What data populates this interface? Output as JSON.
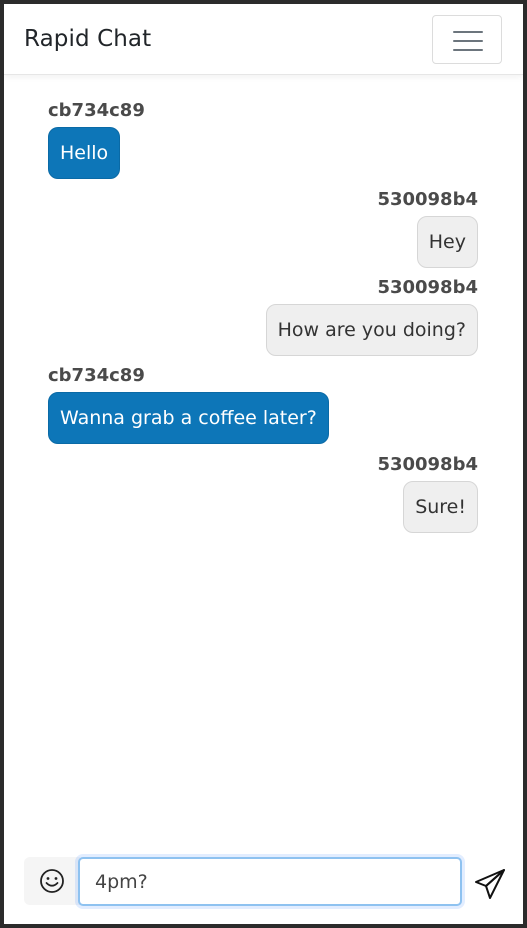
{
  "app": {
    "title": "Rapid Chat"
  },
  "navbar": {
    "menu_icon": "hamburger-menu-icon"
  },
  "messages": [
    {
      "sender": "cb734c89",
      "text": "Hello",
      "side": "left"
    },
    {
      "sender": "530098b4",
      "text": "Hey",
      "side": "right"
    },
    {
      "sender": "530098b4",
      "text": "How are you doing?",
      "side": "right"
    },
    {
      "sender": "cb734c89",
      "text": "Wanna grab a coffee later?",
      "side": "left"
    },
    {
      "sender": "530098b4",
      "text": "Sure!",
      "side": "right"
    }
  ],
  "composer": {
    "value": "4pm?",
    "emoji_icon": "smiley-face-icon",
    "send_icon": "paper-plane-icon"
  },
  "colors": {
    "own_bubble": "#0d76b8",
    "other_bubble": "#efefef",
    "input_focus": "#8ec2f0"
  }
}
